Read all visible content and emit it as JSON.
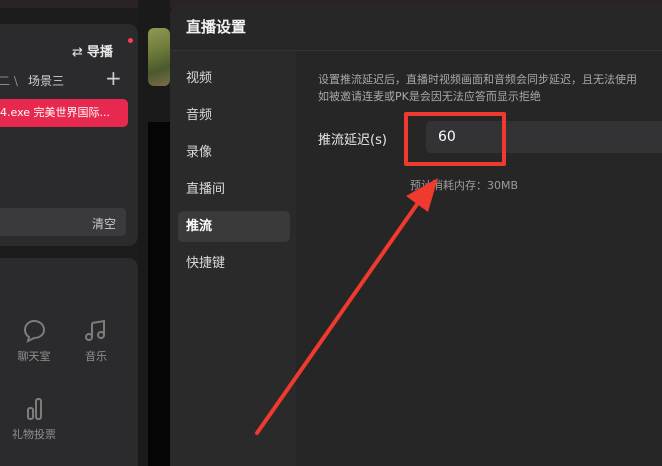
{
  "background_app": {
    "director_label": "导播",
    "director_switch_icon": "⇄",
    "scene_prev_fragment": "二 \\",
    "scene_label": "场景三",
    "add_scene": "+",
    "source_item_label": "4.exe 完美世界国际...",
    "clear_label": "清空",
    "tools": [
      {
        "icon": "chat-icon",
        "label": "聊天室"
      },
      {
        "icon": "music-icon",
        "label": "音乐"
      },
      {
        "icon": "poll-icon",
        "label": "礼物投票"
      }
    ]
  },
  "dialog": {
    "title": "直播设置",
    "nav": [
      {
        "label": "视频",
        "active": false
      },
      {
        "label": "音频",
        "active": false
      },
      {
        "label": "录像",
        "active": false
      },
      {
        "label": "直播间",
        "active": false
      },
      {
        "label": "推流",
        "active": true
      },
      {
        "label": "快捷键",
        "active": false
      }
    ],
    "description_line1": "设置推流延迟后，直播时视频画面和音频会同步延迟，且无法使用",
    "description_line2": "如被邀请连麦或PK是会因无法应答而显示拒绝",
    "delay_label": "推流延迟(s)",
    "delay_value": "60",
    "memory_text": "预计消耗内存：30MB"
  },
  "annotation": {
    "color": "#f0392f",
    "type": "highlight-box-with-arrow"
  }
}
